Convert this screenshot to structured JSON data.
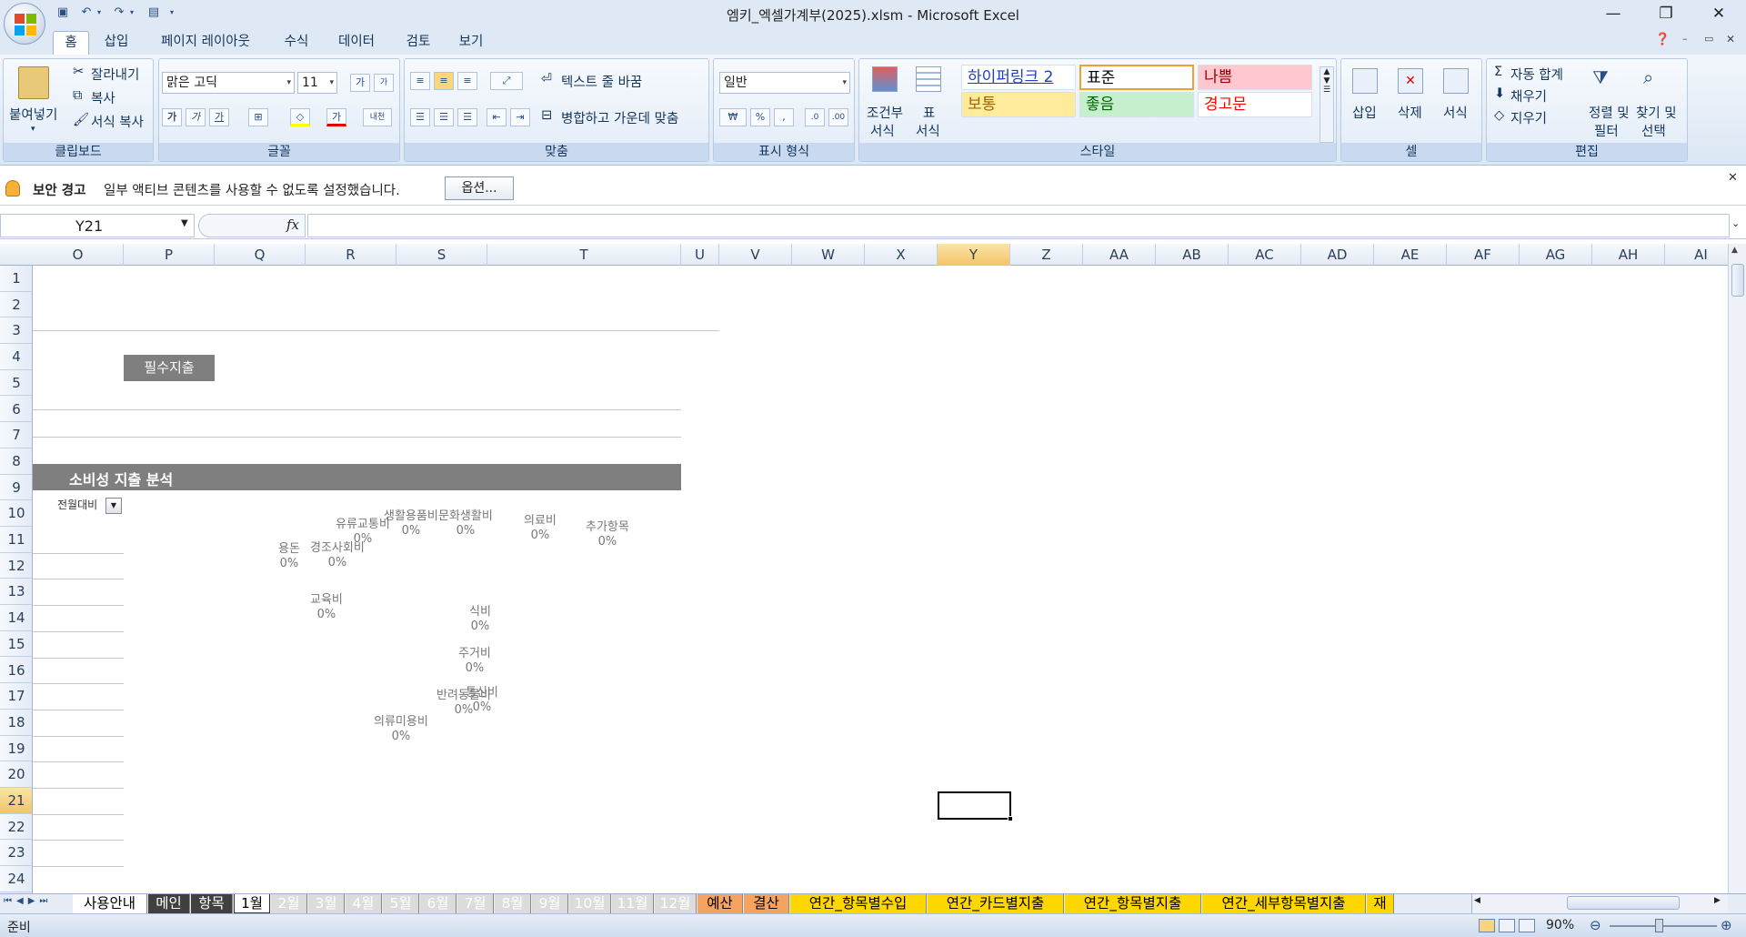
{
  "window": {
    "title": "엠키_엑셀가계부(2025).xlsm - Microsoft Excel",
    "minimize": "—",
    "restore": "❐",
    "close": "✕"
  },
  "ribbon": {
    "tabs": [
      "홈",
      "삽입",
      "페이지 레이아웃",
      "수식",
      "데이터",
      "검토",
      "보기"
    ],
    "active_tab": "홈",
    "clipboard": {
      "paste": "붙여넣기",
      "cut": "잘라내기",
      "copy": "복사",
      "format_painter": "서식 복사",
      "label": "클립보드"
    },
    "font": {
      "name": "맑은 고딕",
      "size": "11",
      "label": "글꼴",
      "grow": "가",
      "shrink": "가",
      "bold": "가",
      "italic": "가",
      "underline": "가",
      "font_color": "가",
      "phonetic": "내천"
    },
    "alignment": {
      "wrap": "텍스트 줄 바꿈",
      "merge": "병합하고 가운데 맞춤",
      "label": "맞춤"
    },
    "number": {
      "format": "일반",
      "currency": "₩",
      "percent": "%",
      "comma": ",",
      "label": "표시 형식"
    },
    "styles": {
      "conditional": "조건부\n서식",
      "conditional_l1": "조건부",
      "conditional_l2": "서식",
      "table_l1": "표",
      "table_l2": "서식",
      "cells": [
        {
          "label": "하이퍼링크 2",
          "bg": "#ffffff",
          "color": "#1d3ec6"
        },
        {
          "label": "표준",
          "bg": "#ffffff",
          "color": "#000000"
        },
        {
          "label": "나쁨",
          "bg": "#ffc7ce",
          "color": "#9c0006"
        },
        {
          "label": "보통",
          "bg": "#ffeb9c",
          "color": "#9c6500"
        },
        {
          "label": "좋음",
          "bg": "#c6efce",
          "color": "#006100"
        },
        {
          "label": "경고문",
          "bg": "#ffffff",
          "color": "#ff0000"
        }
      ],
      "label": "스타일"
    },
    "cells": {
      "insert": "삽입",
      "delete": "삭제",
      "format": "서식",
      "label": "셀"
    },
    "editing": {
      "autosum": "자동 합계",
      "fill": "채우기",
      "clear": "지우기",
      "sort_l1": "정렬 및",
      "sort_l2": "필터",
      "find_l1": "찾기 및",
      "find_l2": "선택",
      "label": "편집"
    }
  },
  "security": {
    "title": "보안 경고",
    "message": "일부 액티브 콘텐츠를 사용할 수 없도록 설정했습니다.",
    "options": "옵션..."
  },
  "formula_bar": {
    "name_box": "Y21",
    "fx": "fx",
    "formula": ""
  },
  "sheet": {
    "columns": [
      {
        "name": "O",
        "w": 100
      },
      {
        "name": "P",
        "w": 100
      },
      {
        "name": "Q",
        "w": 100
      },
      {
        "name": "R",
        "w": 100
      },
      {
        "name": "S",
        "w": 100
      },
      {
        "name": "T",
        "w": 213
      },
      {
        "name": "U",
        "w": 42
      },
      {
        "name": "V",
        "w": 80
      },
      {
        "name": "W",
        "w": 80
      },
      {
        "name": "X",
        "w": 80
      },
      {
        "name": "Y",
        "w": 80
      },
      {
        "name": "Z",
        "w": 80
      },
      {
        "name": "AA",
        "w": 80
      },
      {
        "name": "AB",
        "w": 80
      },
      {
        "name": "AC",
        "w": 80
      },
      {
        "name": "AD",
        "w": 80
      },
      {
        "name": "AE",
        "w": 80
      },
      {
        "name": "AF",
        "w": 80
      },
      {
        "name": "AG",
        "w": 80
      },
      {
        "name": "AH",
        "w": 80
      },
      {
        "name": "AI",
        "w": 80
      }
    ],
    "selected_column": "Y",
    "rows": [
      "1",
      "2",
      "3",
      "4",
      "5",
      "6",
      "7",
      "8",
      "9",
      "10",
      "11",
      "12",
      "13",
      "14",
      "15",
      "16",
      "17",
      "18",
      "19",
      "20",
      "21",
      "22",
      "23",
      "24"
    ],
    "selected_row": "21",
    "essential_button": "필수지출",
    "section_title": "소비성 지출 분석",
    "filter_label": "전월대비",
    "chart_labels": [
      {
        "name": "유류교통비",
        "value": "0%"
      },
      {
        "name": "생활용품비",
        "value": "0%"
      },
      {
        "name": "문화생활비",
        "value": "0%"
      },
      {
        "name": "의료비",
        "value": "0%"
      },
      {
        "name": "추가항목",
        "value": "0%"
      },
      {
        "name": "용돈",
        "value": "0%"
      },
      {
        "name": "경조사회비",
        "value": "0%"
      },
      {
        "name": "교육비",
        "value": "0%"
      },
      {
        "name": "식비",
        "value": "0%"
      },
      {
        "name": "주거비",
        "value": "0%"
      },
      {
        "name": "반려동물비",
        "value": "0%"
      },
      {
        "name": "통신비",
        "value": "0%"
      },
      {
        "name": "의류미용비",
        "value": "0%"
      }
    ]
  },
  "sheet_tabs": [
    {
      "name": "사용안내",
      "bg": "#ffffff",
      "color": "#000000"
    },
    {
      "name": "메인",
      "bg": "#404040",
      "color": "#ffffff"
    },
    {
      "name": "항목",
      "bg": "#404040",
      "color": "#ffffff"
    },
    {
      "name": "1월",
      "bg": "#ffffff",
      "color": "#000000"
    },
    {
      "name": "2월",
      "bg": "#dcdcdc",
      "color": "#ffffff"
    },
    {
      "name": "3월",
      "bg": "#dcdcdc",
      "color": "#ffffff"
    },
    {
      "name": "4월",
      "bg": "#dcdcdc",
      "color": "#ffffff"
    },
    {
      "name": "5월",
      "bg": "#dcdcdc",
      "color": "#ffffff"
    },
    {
      "name": "6월",
      "bg": "#dcdcdc",
      "color": "#ffffff"
    },
    {
      "name": "7월",
      "bg": "#dcdcdc",
      "color": "#ffffff"
    },
    {
      "name": "8월",
      "bg": "#dcdcdc",
      "color": "#ffffff"
    },
    {
      "name": "9월",
      "bg": "#dcdcdc",
      "color": "#ffffff"
    },
    {
      "name": "10월",
      "bg": "#dcdcdc",
      "color": "#ffffff"
    },
    {
      "name": "11월",
      "bg": "#dcdcdc",
      "color": "#ffffff"
    },
    {
      "name": "12월",
      "bg": "#dcdcdc",
      "color": "#ffffff"
    },
    {
      "name": "예산",
      "bg": "#f4a460",
      "color": "#000000"
    },
    {
      "name": "결산",
      "bg": "#f4a460",
      "color": "#000000"
    },
    {
      "name": "연간_항목별수입",
      "bg": "#ffd700",
      "color": "#000000"
    },
    {
      "name": "연간_카드별지출",
      "bg": "#ffd700",
      "color": "#000000"
    },
    {
      "name": "연간_항목별지출",
      "bg": "#ffd700",
      "color": "#000000"
    },
    {
      "name": "연간_세부항목별지출",
      "bg": "#ffd700",
      "color": "#000000"
    },
    {
      "name": "재",
      "bg": "#ffd700",
      "color": "#000000"
    }
  ],
  "status": {
    "ready": "준비",
    "zoom": "90%"
  }
}
